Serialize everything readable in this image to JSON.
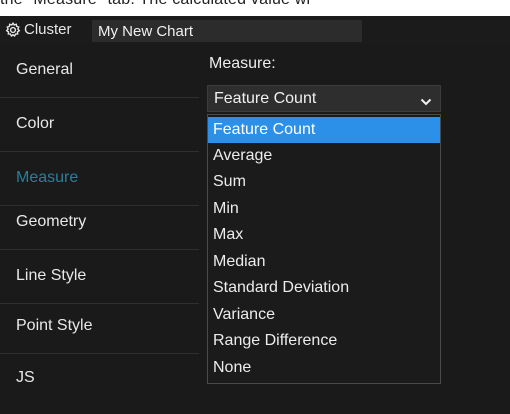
{
  "top_strip_text": "the \"Measure\" tab. The calculated value wi",
  "header": {
    "title": "Cluster",
    "name_value": "My New Chart"
  },
  "sidebar": {
    "items": [
      {
        "label": "General",
        "active": false
      },
      {
        "label": "Color",
        "active": false
      },
      {
        "label": "Measure",
        "active": true
      },
      {
        "label": "Geometry",
        "active": false
      },
      {
        "label": "Line Style",
        "active": false
      },
      {
        "label": "Point Style",
        "active": false
      },
      {
        "label": "JS",
        "active": false
      }
    ]
  },
  "measure": {
    "heading": "Measure:",
    "selected_value": "Feature Count",
    "options": [
      "Feature Count",
      "Average",
      "Sum",
      "Min",
      "Max",
      "Median",
      "Standard Deviation",
      "Variance",
      "Range Difference",
      "None"
    ]
  },
  "colors": {
    "active_tab": "#2a7f99",
    "highlight": "#2c8fe8",
    "background": "#1a1a1a"
  },
  "icons": {
    "header": "gear-icon",
    "select": "chevron-down-icon"
  }
}
